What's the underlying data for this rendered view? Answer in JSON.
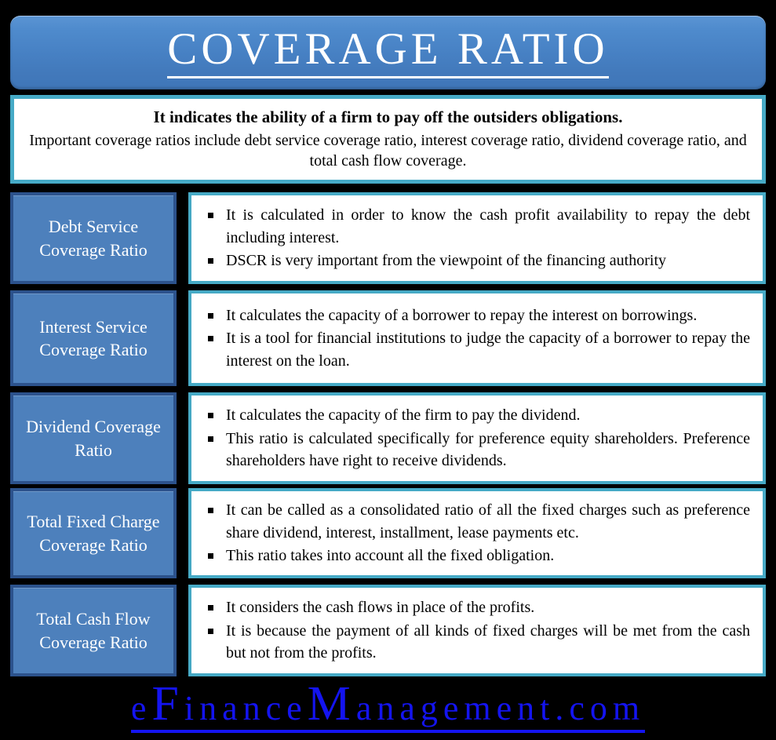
{
  "header": {
    "title": "COVERAGE RATIO"
  },
  "intro": {
    "line1": "It indicates the ability of a firm to pay off the outsiders obligations.",
    "line2": "Important coverage ratios include debt service coverage ratio, interest coverage ratio, dividend coverage ratio, and total cash flow coverage."
  },
  "rows": [
    {
      "label": "Debt Service Coverage Ratio",
      "bullets": [
        "It is  calculated in order to know the cash profit availability to repay the debt including interest.",
        "DSCR is very important from the viewpoint of the financing authority"
      ]
    },
    {
      "label": "Interest Service Coverage Ratio",
      "bullets": [
        "It calculates the capacity of a borrower to repay the interest on borrowings.",
        "It is a tool for financial institutions to judge the capacity of a borrower to repay the interest on the loan."
      ]
    },
    {
      "label": "Dividend Coverage Ratio",
      "bullets": [
        "It calculates the capacity of the firm to pay the dividend.",
        "This ratio is calculated specifically for preference equity shareholders. Preference shareholders have right to receive dividends."
      ]
    },
    {
      "label": "Total Fixed Charge Coverage Ratio",
      "bullets": [
        "It can be called as a consolidated ratio of all the fixed charges such as preference share dividend, interest, installment, lease payments etc.",
        "This ratio takes into account all the fixed obligation."
      ]
    },
    {
      "label": "Total Cash Flow Coverage Ratio",
      "bullets": [
        "It considers the cash flows in place of the profits.",
        "It is because the payment of all kinds of fixed charges will be met from the cash but not from the profits."
      ]
    }
  ],
  "footer": {
    "logo_parts": [
      "e",
      "F",
      "inance",
      "M",
      "anagement.com"
    ],
    "logo_text": "eFinanceManagement.com"
  },
  "colors": {
    "background": "#000000",
    "header_blue": "#4781c4",
    "label_blue": "#4d80bc",
    "label_border": "#2c528c",
    "teal_border": "#46aac6",
    "logo_blue": "#1414f0",
    "text": "#000000"
  }
}
